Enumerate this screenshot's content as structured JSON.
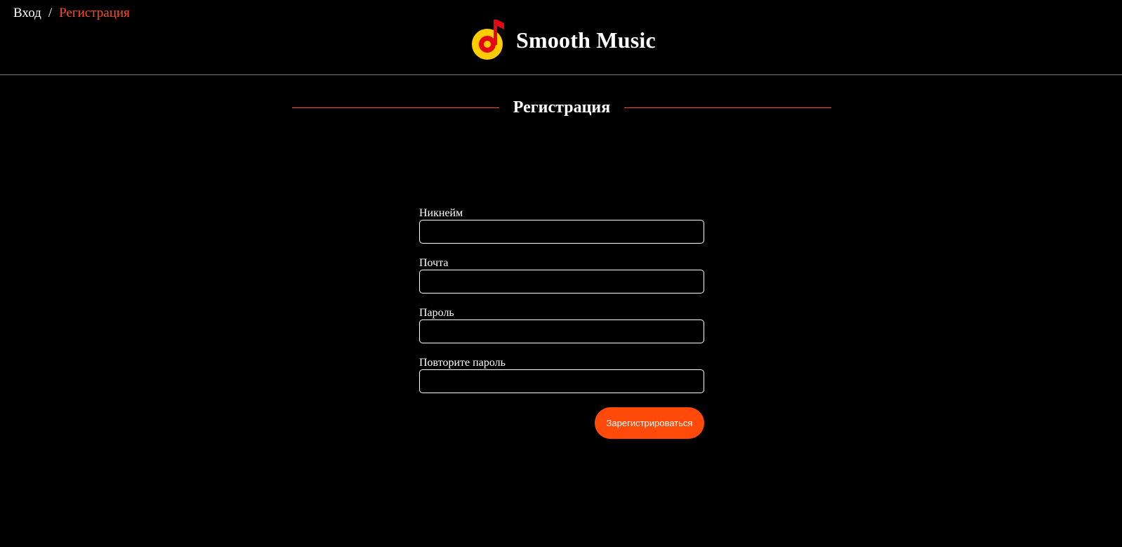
{
  "breadcrumb": {
    "login_label": "Вход",
    "separator": "/",
    "current_label": "Регистрация"
  },
  "brand": {
    "title": "Smooth Music",
    "logo_icon": "music-note-logo-icon"
  },
  "section": {
    "title": "Регистрация"
  },
  "form": {
    "fields": [
      {
        "label": "Никнейм",
        "value": "",
        "placeholder": ""
      },
      {
        "label": "Почта",
        "value": "",
        "placeholder": ""
      },
      {
        "label": "Пароль",
        "value": "",
        "placeholder": ""
      },
      {
        "label": "Повторите пароль",
        "value": "",
        "placeholder": ""
      }
    ],
    "submit_label": "Зарегистрироваться"
  },
  "colors": {
    "background": "#000000",
    "accent": "#ff4a1c",
    "button": "#ff4a0a",
    "logo_yellow": "#ffcc00",
    "logo_red": "#e30613"
  }
}
